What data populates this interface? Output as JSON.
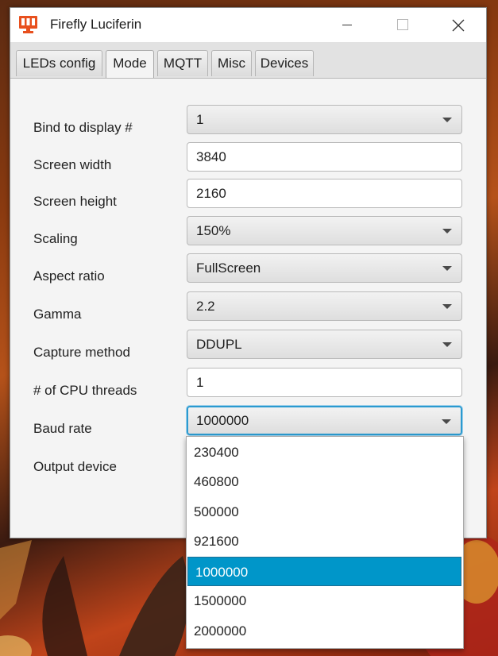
{
  "window": {
    "title": "Firefly Luciferin"
  },
  "tabs": [
    {
      "label": "LEDs config"
    },
    {
      "label": "Mode"
    },
    {
      "label": "MQTT"
    },
    {
      "label": "Misc"
    },
    {
      "label": "Devices"
    }
  ],
  "active_tab": "Mode",
  "form": {
    "bind_display": {
      "label": "Bind to display #",
      "value": "1"
    },
    "screen_width": {
      "label": "Screen width",
      "value": "3840"
    },
    "screen_height": {
      "label": "Screen height",
      "value": "2160"
    },
    "scaling": {
      "label": "Scaling",
      "value": "150%"
    },
    "aspect_ratio": {
      "label": "Aspect ratio",
      "value": "FullScreen"
    },
    "gamma": {
      "label": "Gamma",
      "value": "2.2"
    },
    "capture_method": {
      "label": "Capture method",
      "value": "DDUPL"
    },
    "cpu_threads": {
      "label": "# of CPU threads",
      "value": "1"
    },
    "baud_rate": {
      "label": "Baud rate",
      "value": "1000000"
    },
    "output_device": {
      "label": "Output device"
    }
  },
  "baud_dropdown": {
    "options": [
      "230400",
      "460800",
      "500000",
      "921600",
      "1000000",
      "1500000",
      "2000000"
    ],
    "selected": "1000000"
  },
  "colors": {
    "accent": "#0096c9",
    "focus_border": "#2b9ad0",
    "icon": "#e8501e"
  },
  "icons": [
    "app-icon",
    "minimize-icon",
    "maximize-icon",
    "close-icon",
    "dropdown-arrow-icon"
  ]
}
